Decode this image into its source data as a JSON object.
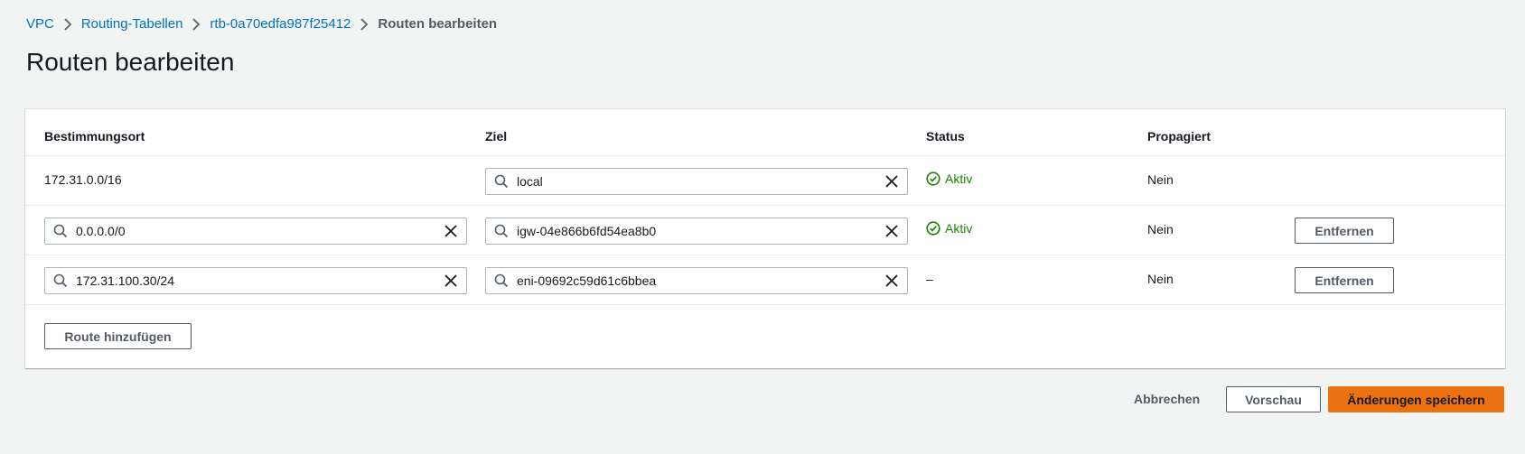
{
  "breadcrumb": {
    "items": [
      "VPC",
      "Routing-Tabellen",
      "rtb-0a70edfa987f25412"
    ],
    "current": "Routen bearbeiten"
  },
  "page": {
    "title": "Routen bearbeiten"
  },
  "table": {
    "headers": {
      "destination": "Bestimmungsort",
      "target": "Ziel",
      "status": "Status",
      "propagated": "Propagiert"
    },
    "rows": [
      {
        "destination": "172.31.0.0/16",
        "target": "local",
        "status": "Aktiv",
        "propagated": "Nein"
      },
      {
        "destination": "0.0.0.0/0",
        "target": "igw-04e866b6fd54ea8b0",
        "status": "Aktiv",
        "propagated": "Nein",
        "remove_label": "Entfernen"
      },
      {
        "destination": "172.31.100.30/24",
        "target": "eni-09692c59d61c6bbea",
        "status": "–",
        "propagated": "Nein",
        "remove_label": "Entfernen"
      }
    ],
    "add_route_label": "Route hinzufügen"
  },
  "footer": {
    "cancel_label": "Abbrechen",
    "preview_label": "Vorschau",
    "save_label": "Änderungen speichern"
  },
  "colors": {
    "link": "#0073bb",
    "success": "#1d8102",
    "primary": "#ec7211"
  }
}
